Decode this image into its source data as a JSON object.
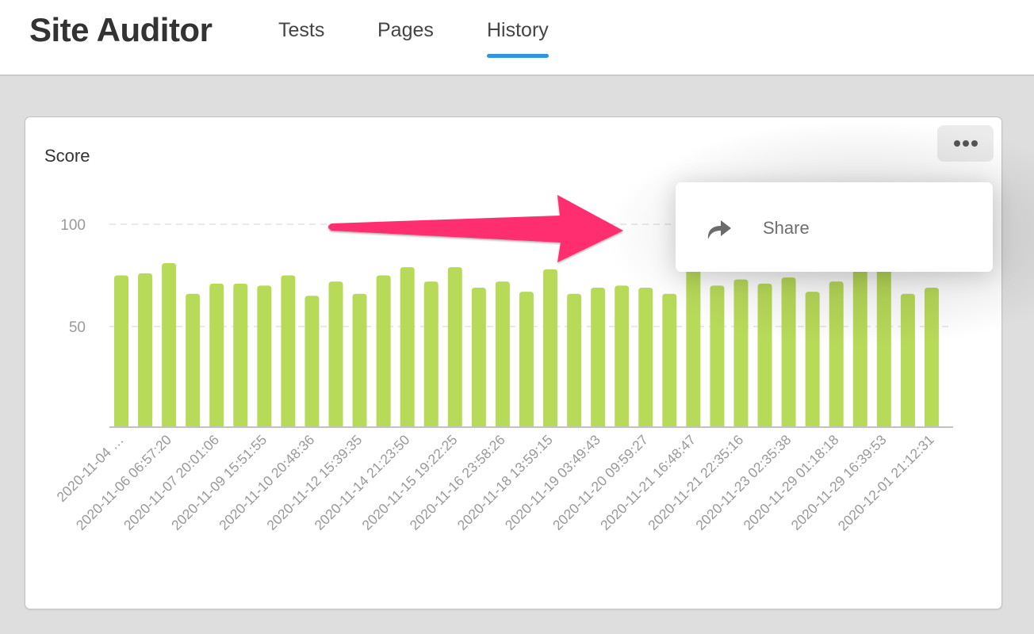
{
  "header": {
    "app_title": "Site Auditor",
    "tabs": [
      {
        "label": "Tests",
        "active": false
      },
      {
        "label": "Pages",
        "active": false
      },
      {
        "label": "History",
        "active": true
      }
    ],
    "accent_color": "#2f95e3"
  },
  "card": {
    "title": "Score",
    "more_button_icon": "more-horizontal-icon"
  },
  "menu": {
    "items": [
      {
        "label": "Share",
        "icon": "share-icon"
      }
    ]
  },
  "annotation": {
    "type": "arrow",
    "color": "#ff2d6f",
    "points_to": "share-menu"
  },
  "chart_data": {
    "type": "bar",
    "title": "Score",
    "xlabel": "",
    "ylabel": "",
    "ylim": [
      0,
      100
    ],
    "yticks": [
      50,
      100
    ],
    "grid": "horizontal-dashed",
    "bar_color": "#b8da59",
    "categories": [
      "2020-11-04 …",
      "",
      "2020-11-06 06:57:20",
      "",
      "2020-11-07 20:01:06",
      "",
      "2020-11-09 15:51:55",
      "",
      "2020-11-10 20:48:36",
      "",
      "2020-11-12 15:39:35",
      "",
      "2020-11-14 21:23:50",
      "",
      "2020-11-15 19:22:25",
      "",
      "2020-11-16 23:58:26",
      "",
      "2020-11-18 13:59:15",
      "",
      "2020-11-19 03:49:43",
      "",
      "2020-11-20 09:59:27",
      "",
      "2020-11-21 16:48:47",
      "",
      "2020-11-21 22:35:16",
      "",
      "2020-11-23 02:35:38",
      "",
      "2020-11-29 01:18:18",
      "",
      "2020-11-29 16:39:53",
      "",
      "2020-12-01 21:12:31"
    ],
    "values": [
      75,
      76,
      81,
      66,
      71,
      71,
      70,
      75,
      65,
      72,
      66,
      75,
      79,
      72,
      79,
      69,
      72,
      67,
      78,
      66,
      69,
      70,
      69,
      66,
      78,
      70,
      73,
      71,
      74,
      67,
      72,
      79,
      80,
      66,
      69
    ]
  }
}
